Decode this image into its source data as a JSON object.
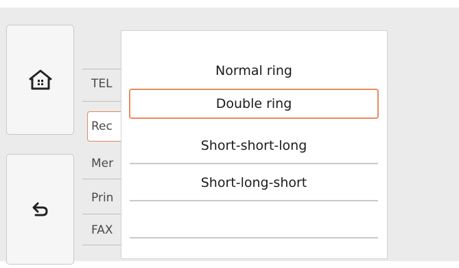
{
  "sidebar": {
    "home_icon": "home-icon",
    "back_icon": "back-arrow-icon"
  },
  "background_menu": {
    "items": [
      "TEL",
      "Rec",
      "Mer",
      "Prin",
      "FAX"
    ]
  },
  "ring_popup": {
    "options": [
      "Normal ring",
      "Double ring",
      "Short-short-long",
      "Short-long-short"
    ],
    "selected_index": 1
  },
  "colors": {
    "selection_border": "#e88c5a",
    "screen_background": "#ecebec"
  }
}
